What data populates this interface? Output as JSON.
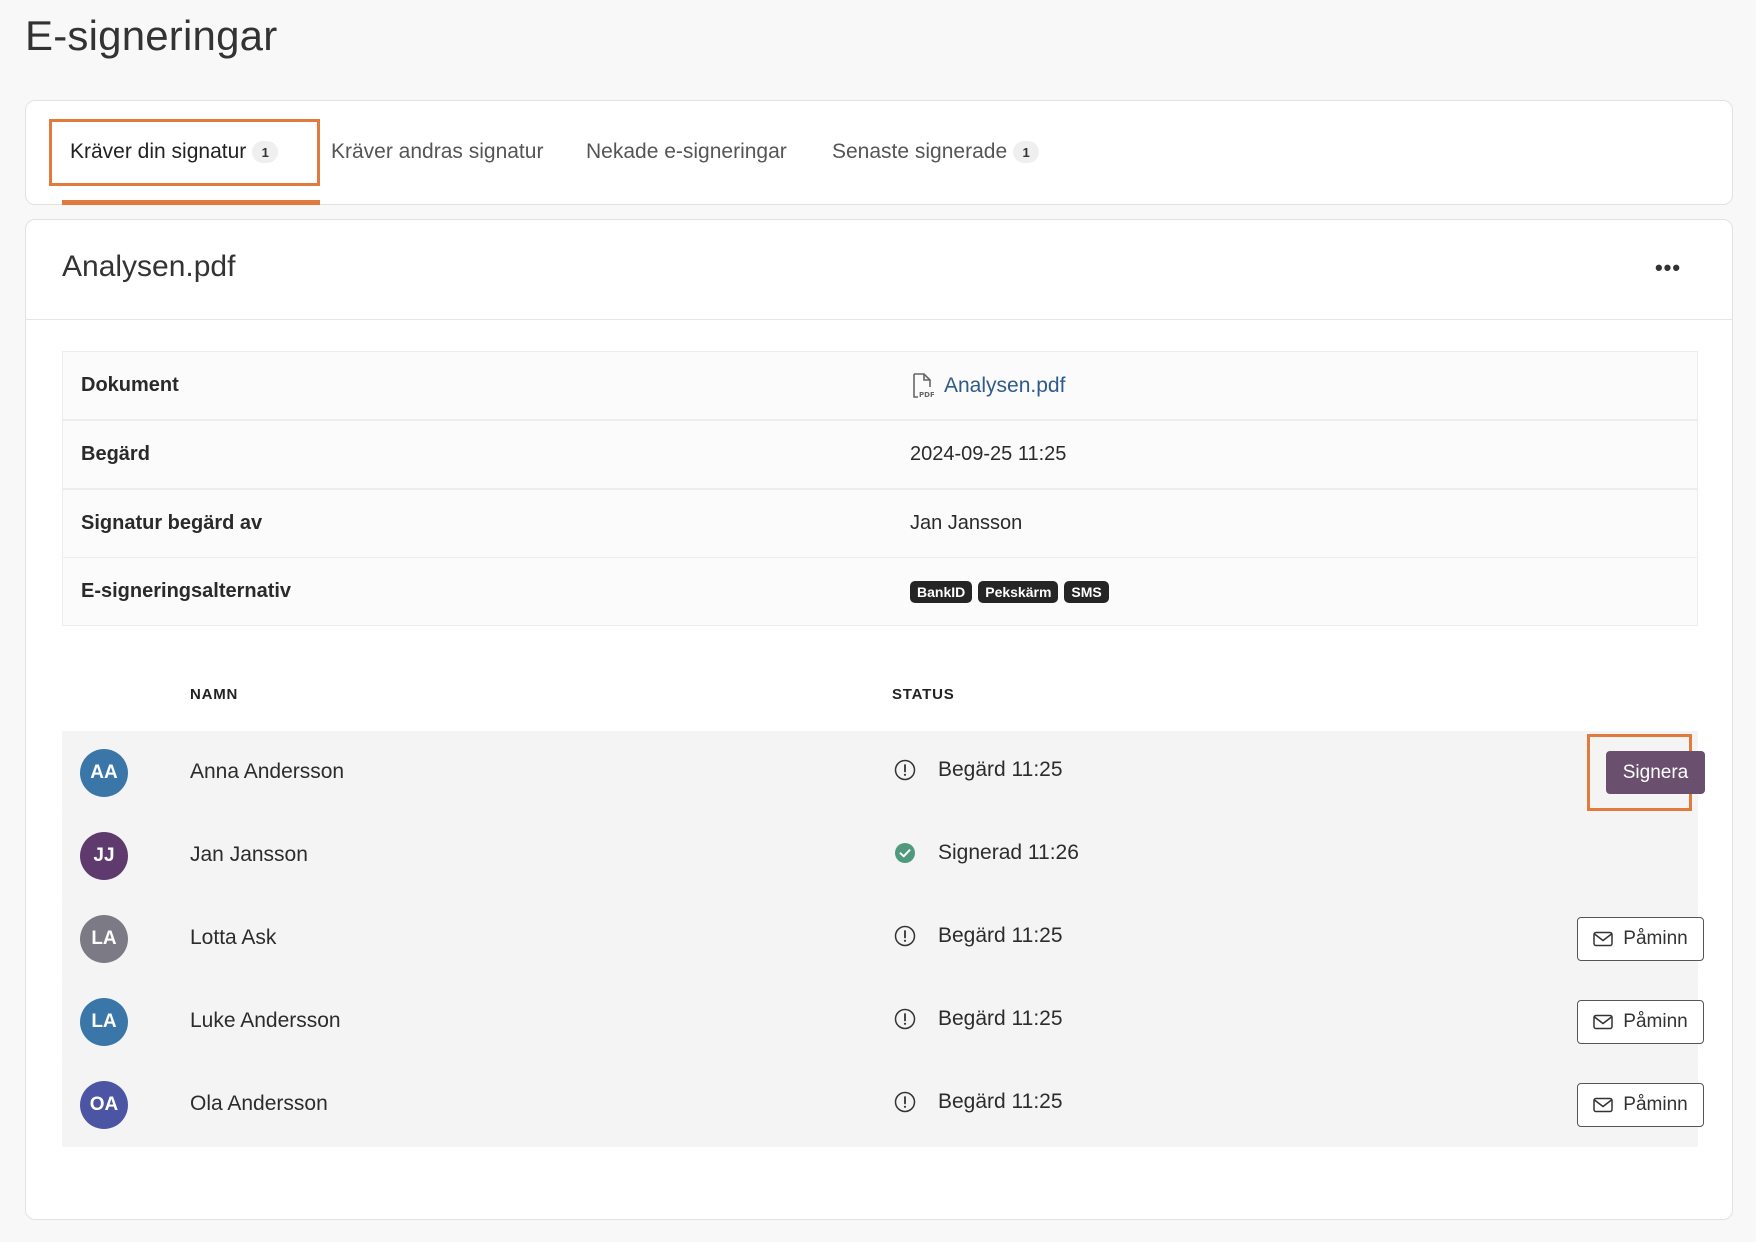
{
  "page": {
    "title": "E-signeringar"
  },
  "tabs": [
    {
      "label": "Kräver din signatur",
      "badge": "1",
      "active": true
    },
    {
      "label": "Kräver andras signatur",
      "badge": "",
      "active": false
    },
    {
      "label": "Nekade e-signeringar",
      "badge": "",
      "active": false
    },
    {
      "label": "Senaste signerade",
      "badge": "1",
      "active": false
    }
  ],
  "document": {
    "title": "Analysen.pdf",
    "more_icon": "ellipsis-icon",
    "info": [
      {
        "label": "Dokument",
        "value": "Analysen.pdf",
        "icon": "pdf-file-icon"
      },
      {
        "label": "Begärd",
        "value": "2024-09-25 11:25"
      },
      {
        "label": "Signatur begärd av",
        "value": "Jan Jansson"
      },
      {
        "label": "E-signeringsalternativ",
        "chips": [
          "BankID",
          "Pekskärm",
          "SMS"
        ]
      }
    ]
  },
  "signers_table": {
    "headers": {
      "name": "NAMN",
      "status": "STATUS"
    },
    "rows": [
      {
        "initials": "AA",
        "avatar_color": "#3a76a8",
        "name": "Anna Andersson",
        "status": "Begärd 11:25",
        "status_icon": "exclamation-circle-icon",
        "action": "Signera"
      },
      {
        "initials": "JJ",
        "avatar_color": "#5e3a6e",
        "name": "Jan Jansson",
        "status": "Signerad 11:26",
        "status_icon": "check-circle-icon",
        "action": ""
      },
      {
        "initials": "LA",
        "avatar_color": "#7c7a85",
        "name": "Lotta Ask",
        "status": "Begärd 11:25",
        "status_icon": "exclamation-circle-icon",
        "action": "Påminn"
      },
      {
        "initials": "LA",
        "avatar_color": "#3a76a8",
        "name": "Luke Andersson",
        "status": "Begärd 11:25",
        "status_icon": "exclamation-circle-icon",
        "action": "Påminn"
      },
      {
        "initials": "OA",
        "avatar_color": "#4b55a3",
        "name": "Ola Andersson",
        "status": "Begärd 11:25",
        "status_icon": "exclamation-circle-icon",
        "action": "Påminn"
      }
    ]
  },
  "colors": {
    "highlight": "#e27a3e",
    "sign_button": "#6a4f6e",
    "link": "#2f5b8a",
    "signed_green": "#4f9a7c"
  }
}
